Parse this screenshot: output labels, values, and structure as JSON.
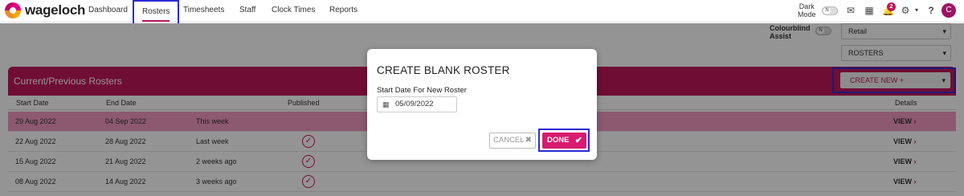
{
  "nav": {
    "brand": "wageloch",
    "items": [
      "Dashboard",
      "Rosters",
      "Timesheets",
      "Staff",
      "Clock Times",
      "Reports"
    ],
    "dark_mode_line1": "Dark",
    "dark_mode_line2": "Mode",
    "dark_mode_state": "N",
    "notification_count": "2",
    "avatar_initial": "C"
  },
  "toolbar": {
    "colourblind_line1": "Colourblind",
    "colourblind_line2": "Assist",
    "colourblind_state": "N",
    "location_select": "Retail",
    "view_select": "ROSTERS",
    "create_new": "CREATE NEW +"
  },
  "panel": {
    "title": "Current/Previous Rosters",
    "columns": {
      "start": "Start Date",
      "end": "End Date",
      "published": "Published",
      "details": "Details"
    },
    "rows": [
      {
        "start": "29 Aug 2022",
        "end": "04 Sep 2022",
        "note": "This week",
        "view": "VIEW"
      },
      {
        "start": "22 Aug 2022",
        "end": "28 Aug 2022",
        "note": "Last week",
        "view": "VIEW"
      },
      {
        "start": "15 Aug 2022",
        "end": "21 Aug 2022",
        "note": "2 weeks ago",
        "view": "VIEW"
      },
      {
        "start": "08 Aug 2022",
        "end": "14 Aug 2022",
        "note": "3 weeks ago",
        "view": "VIEW"
      }
    ]
  },
  "modal": {
    "title": "CREATE BLANK ROSTER",
    "label": "Start Date For New Roster",
    "date_value": "05/09/2022",
    "cancel": "CANCEL",
    "done": "DONE"
  },
  "colors": {
    "brand": "#c2185b",
    "done_button": "#d81b70",
    "highlight_row": "#f29ac2",
    "focus_outline": "#2b2bd6"
  }
}
